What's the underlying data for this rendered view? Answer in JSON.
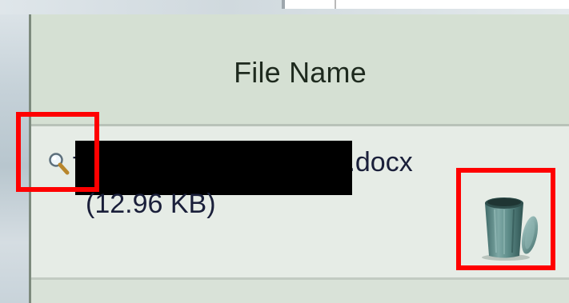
{
  "table": {
    "header": {
      "file_name_label": "File Name"
    },
    "rows": [
      {
        "file_prefix": "f",
        "file_extension": ".docx",
        "file_size": "(12.96 KB)",
        "preview_icon": "magnifier-icon",
        "delete_icon": "trash-can-icon"
      }
    ]
  },
  "colors": {
    "header_bg": "#d5e0d3",
    "row_bg": "#e6ece6",
    "text": "#1a1f3a",
    "highlight": "#ff0000",
    "redaction": "#000000"
  }
}
